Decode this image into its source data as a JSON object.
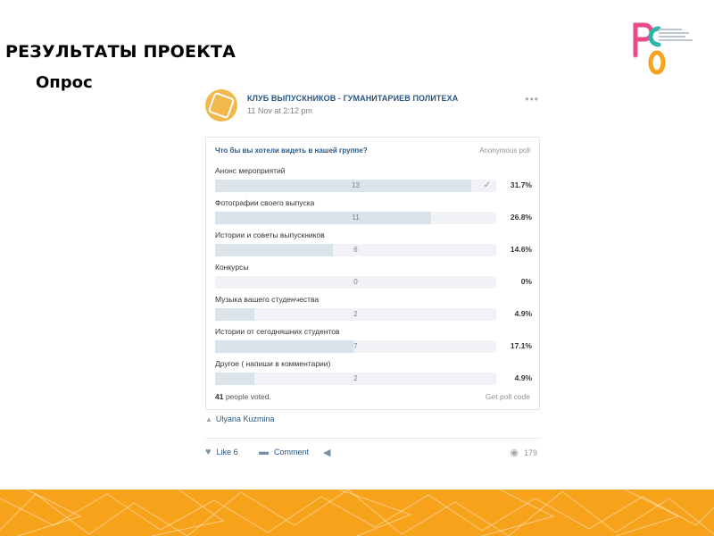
{
  "slide": {
    "title": "РЕЗУЛЬТАТЫ ПРОЕКТА",
    "subtitle": "Опрос"
  },
  "logo": {
    "text": "РСО"
  },
  "post": {
    "group_name": "КЛУБ ВЫПУСКНИКОВ - ГУМАНИТАРИЕВ ПОЛИТЕХА",
    "date": "11 Nov at 2:12 pm",
    "more": "•••",
    "poll": {
      "question": "Что бы вы хотели видеть в нашей группе?",
      "type": "Anonymous poll",
      "options": [
        {
          "label": "Анонс мероприятий",
          "count": "13",
          "percent": "31.7%",
          "share": 0.317,
          "voted": true
        },
        {
          "label": "Фотографии своего выпуска",
          "count": "11",
          "percent": "26.8%",
          "share": 0.268,
          "voted": false
        },
        {
          "label": "Истории и советы выпускников",
          "count": "6",
          "percent": "14.6%",
          "share": 0.146,
          "voted": false
        },
        {
          "label": "Конкурсы",
          "count": "0",
          "percent": "0%",
          "share": 0,
          "voted": false
        },
        {
          "label": "Музыка вашего студенчества",
          "count": "2",
          "percent": "4.9%",
          "share": 0.049,
          "voted": false
        },
        {
          "label": "Истории от сегодняшних студентов",
          "count": "7",
          "percent": "17.1%",
          "share": 0.171,
          "voted": false
        },
        {
          "label": "Другое ( напиши в комментарии)",
          "count": "2",
          "percent": "4.9%",
          "share": 0.049,
          "voted": false
        }
      ],
      "voters_count": "41",
      "voters_text": " people voted.",
      "get_code": "Get poll code"
    },
    "author": "Ulyana Kuzmina",
    "actions": {
      "like_label": "Like",
      "like_count": "6",
      "comment_label": "Comment",
      "views": "179"
    }
  },
  "colors": {
    "accent": "#2a5885",
    "bar_fill": "#dae2ea",
    "bar_track": "#f0f2f5",
    "footer": "#f7a21b",
    "avatar": "#f2b84b"
  },
  "icons": {
    "check": "check-icon",
    "author": "person-icon",
    "like": "heart-icon",
    "comment": "comment-icon",
    "share": "megaphone-icon",
    "views": "eye-icon"
  }
}
